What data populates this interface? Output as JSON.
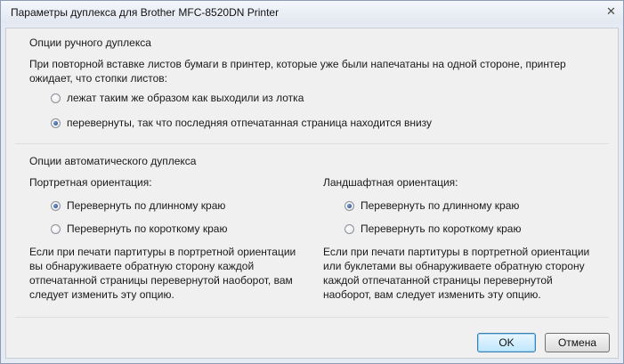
{
  "window": {
    "title": "Параметры дуплекса для Brother MFC-8520DN Printer",
    "close_glyph": "✕"
  },
  "manual": {
    "title": "Опции ручного дуплекса",
    "description": "При повторной вставке листов бумаги в принтер, которые уже были напечатаны на одной стороне, принтер ожидает, что стопки листов:",
    "options": [
      {
        "label": "лежат таким же образом как выходили из лотка",
        "checked": false
      },
      {
        "label": "перевернуты, так что последняя отпечатанная страница находится внизу",
        "checked": true
      }
    ]
  },
  "auto": {
    "title": "Опции автоматического дуплекса",
    "portrait": {
      "label": "Портретная ориентация:",
      "options": [
        {
          "label": "Перевернуть по длинному краю",
          "checked": true
        },
        {
          "label": "Перевернуть по короткому краю",
          "checked": false
        }
      ],
      "description": "Если при печати партитуры в портретной ориентации вы обнаруживаете обратную сторону каждой отпечатанной страницы перевернутой наоборот, вам следует изменить эту опцию."
    },
    "landscape": {
      "label": "Ландшафтная ориентация:",
      "options": [
        {
          "label": "Перевернуть по длинному краю",
          "checked": true
        },
        {
          "label": "Перевернуть по короткому краю",
          "checked": false
        }
      ],
      "description": "Если при печати партитуры в портретной ориентации или буклетами вы обнаруживаете обратную сторону каждой отпечатанной страницы перевернутой наоборот, вам следует изменить эту опцию."
    }
  },
  "buttons": {
    "ok": "OK",
    "cancel": "Отмена"
  }
}
